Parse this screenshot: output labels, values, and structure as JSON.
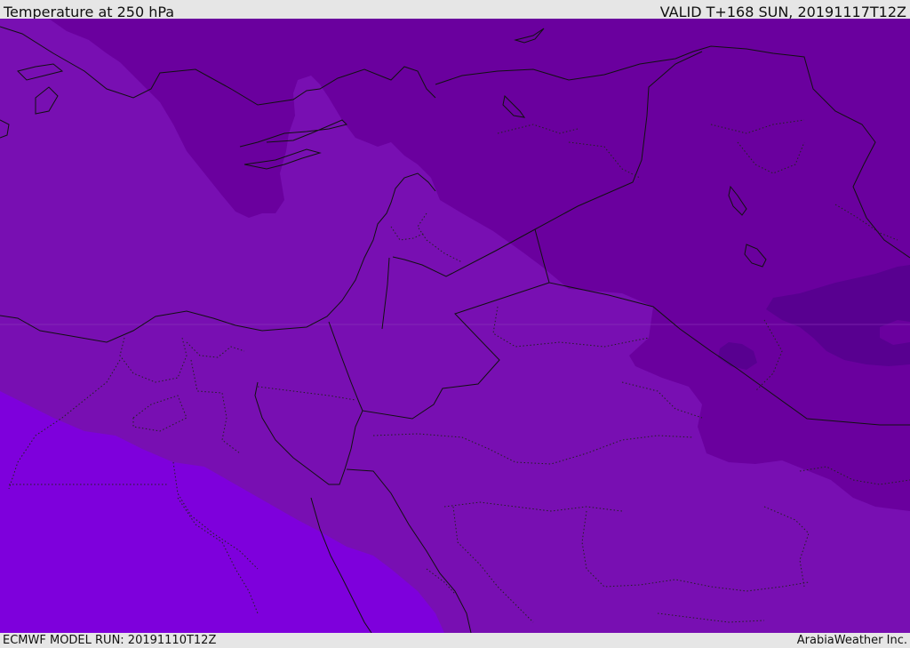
{
  "header": {
    "title": "Temperature at 250 hPa",
    "valid": "VALID T+168 SUN, 20191117T12Z"
  },
  "footer": {
    "model_run": "ECMWF MODEL RUN: 20191110T12Z",
    "credit": "ArabiaWeather Inc."
  },
  "colors": {
    "background": "#e6e6e6",
    "band_cold_darkest": "#580090",
    "band_cold": "#6a009e",
    "band_mid": "#780fb2",
    "band_warm": "#7e00dc"
  }
}
